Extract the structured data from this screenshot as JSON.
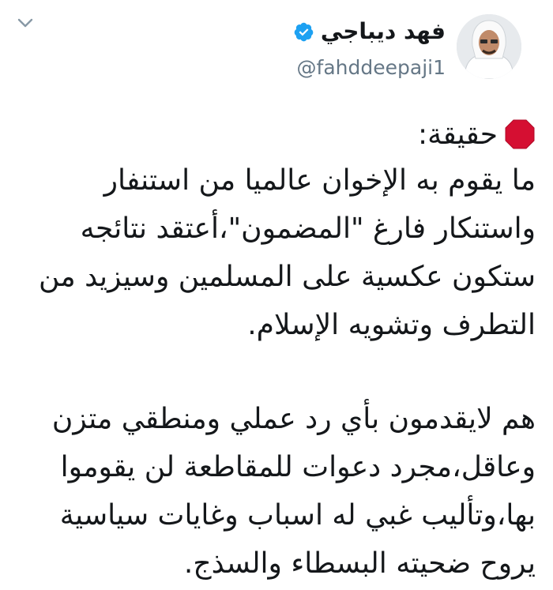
{
  "author": {
    "display_name": "فهد ديباجي",
    "handle": "@fahddeepaji1"
  },
  "icons": {
    "verified": "verified-badge-icon",
    "chevron": "chevron-down-icon",
    "stop": "stop-sign-emoji",
    "verified_color": "#1da1f2",
    "stop_color": "#d50f32"
  },
  "tweet": {
    "lead": "حقيقة:",
    "paragraph1": [
      "ما يقوم به الإخوان عالميا من استنفار",
      "واستنكار فارغ \"المضمون\"،أعتقد نتائجه",
      "ستكون عكسية على المسلمين وسيزيد من",
      "التطرف وتشويه الإسلام."
    ],
    "paragraph2": [
      "هم لايقدمون بأي رد عملي ومنطقي متزن",
      "وعاقل،مجرد دعوات للمقاطعة لن يقوموا",
      "بها،وتأليب غبي له اسباب وغايات سياسية",
      "يروح ضحيته البسطاء والسذج."
    ]
  }
}
